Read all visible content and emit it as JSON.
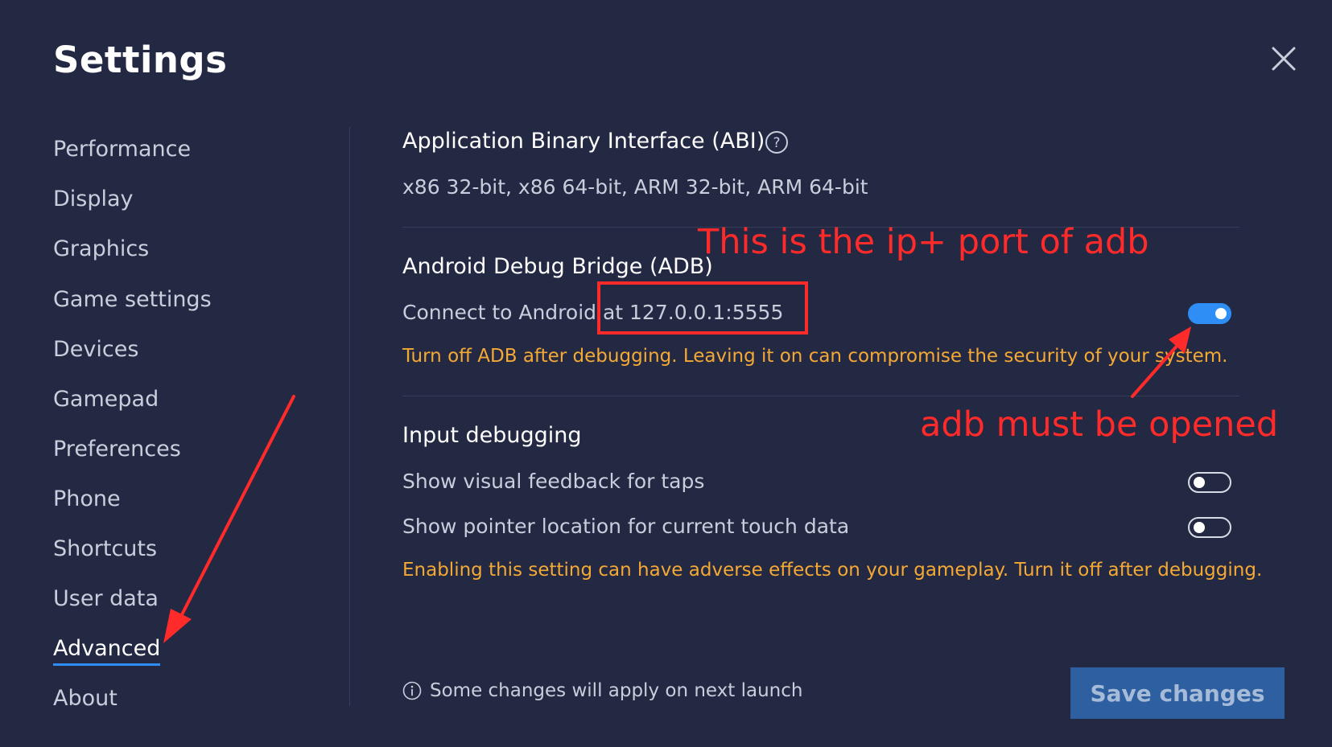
{
  "window": {
    "title": "Settings",
    "close_icon": "close-icon"
  },
  "sidebar": {
    "items": [
      {
        "label": "Performance",
        "active": false
      },
      {
        "label": "Display",
        "active": false
      },
      {
        "label": "Graphics",
        "active": false
      },
      {
        "label": "Game settings",
        "active": false
      },
      {
        "label": "Devices",
        "active": false
      },
      {
        "label": "Gamepad",
        "active": false
      },
      {
        "label": "Preferences",
        "active": false
      },
      {
        "label": "Phone",
        "active": false
      },
      {
        "label": "Shortcuts",
        "active": false
      },
      {
        "label": "User data",
        "active": false
      },
      {
        "label": "Advanced",
        "active": true
      },
      {
        "label": "About",
        "active": false
      }
    ]
  },
  "abi": {
    "title": "Application Binary Interface (ABI)",
    "help_icon": "help-circle-icon",
    "value": "x86 32-bit, x86 64-bit, ARM 32-bit, ARM 64-bit"
  },
  "adb": {
    "title": "Android Debug Bridge (ADB)",
    "connect_label": "Connect to Android at 127.0.0.1:5555",
    "enabled": true,
    "warning": "Turn off ADB after debugging. Leaving it on can compromise the security of your system."
  },
  "input_debugging": {
    "title": "Input debugging",
    "options": [
      {
        "label": "Show visual feedback for taps",
        "enabled": false
      },
      {
        "label": "Show pointer location for current touch data",
        "enabled": false
      }
    ],
    "warning": "Enabling this setting can have adverse effects on your gameplay. Turn it off after debugging."
  },
  "footer": {
    "info_icon": "info-icon",
    "note": "Some changes will apply on next launch",
    "save_label": "Save changes"
  },
  "annotations": {
    "box_label": "This is the ip+ port of adb",
    "toggle_label": "adb must be opened",
    "color": "#ff2a2a"
  },
  "colors": {
    "background": "#232843",
    "accent": "#2f8ef5",
    "warning": "#f5a935",
    "save_button": "#2d5fa1"
  }
}
